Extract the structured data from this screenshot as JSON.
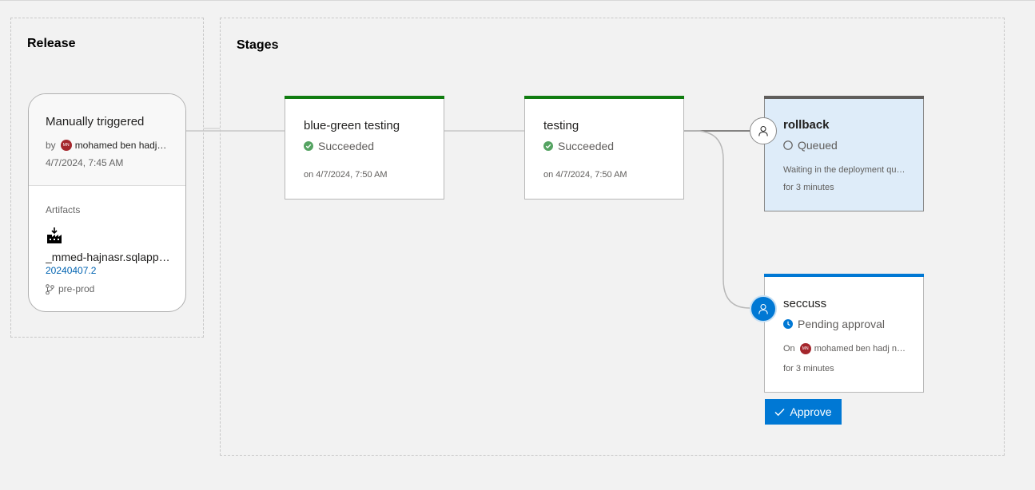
{
  "release": {
    "title": "Release",
    "trigger": "Manually triggered",
    "by_label": "by",
    "by_avatar_initials": "MN",
    "by_name": "mohamed ben hadj…",
    "date": "4/7/2024, 7:45 AM",
    "artifacts_label": "Artifacts",
    "artifact_icon": "build-pipeline-icon",
    "artifact_name": "_mmed-hajnasr.sqlapp…",
    "artifact_build": "20240407.2",
    "artifact_branch": "pre-prod"
  },
  "stages": {
    "title": "Stages",
    "items": [
      {
        "name": "blue-green testing",
        "status": "Succeeded",
        "meta": "on 4/7/2024, 7:50 AM",
        "bar_color": "#107c10"
      },
      {
        "name": "testing",
        "status": "Succeeded",
        "meta": "on 4/7/2024, 7:50 AM",
        "bar_color": "#107c10"
      },
      {
        "name": "rollback",
        "status": "Queued",
        "meta1": "Waiting in the deployment qu…",
        "meta2": "for 3 minutes",
        "bar_color": "#605e5c"
      },
      {
        "name": "seccuss",
        "status": "Pending approval",
        "meta_on": "On",
        "meta_avatar_initials": "MN",
        "meta_name": "mohamed ben hadj n…",
        "meta2": "for 3 minutes",
        "bar_color": "#0078d4"
      }
    ]
  },
  "approve_button": "Approve",
  "colors": {
    "success": "#107c10",
    "accent": "#0078d4",
    "queued_bg": "#deecf9"
  }
}
